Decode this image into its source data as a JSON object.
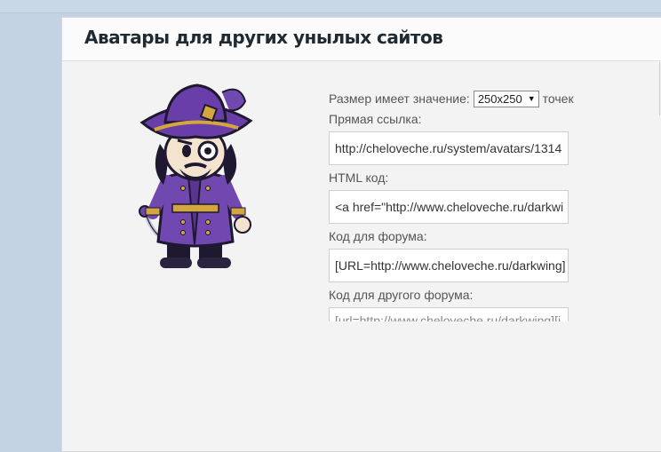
{
  "page": {
    "title": "Аватары для других унылых сайтов"
  },
  "form": {
    "size_prefix": "Размер имеет значение:",
    "size_value": "250x250",
    "size_suffix": "точек",
    "direct_link_label": "Прямая ссылка:",
    "direct_link_value": "http://cheloveche.ru/system/avatars/1314",
    "html_label": "HTML код:",
    "html_value": "<a href=\"http://www.cheloveche.ru/darkwi",
    "forum_label": "Код для форума:",
    "forum_value": "[URL=http://www.cheloveche.ru/darkwing]",
    "other_forum_label": "Код для другого форума:",
    "other_forum_value": "[url=http://www.cheloveche.ru/darkwing][i"
  },
  "avatar": {
    "icon": "pirate-character-avatar",
    "colors": {
      "hat": "#6a3ea8",
      "coat": "#7048b0",
      "trim": "#d4a640",
      "outline": "#1e1830"
    }
  }
}
